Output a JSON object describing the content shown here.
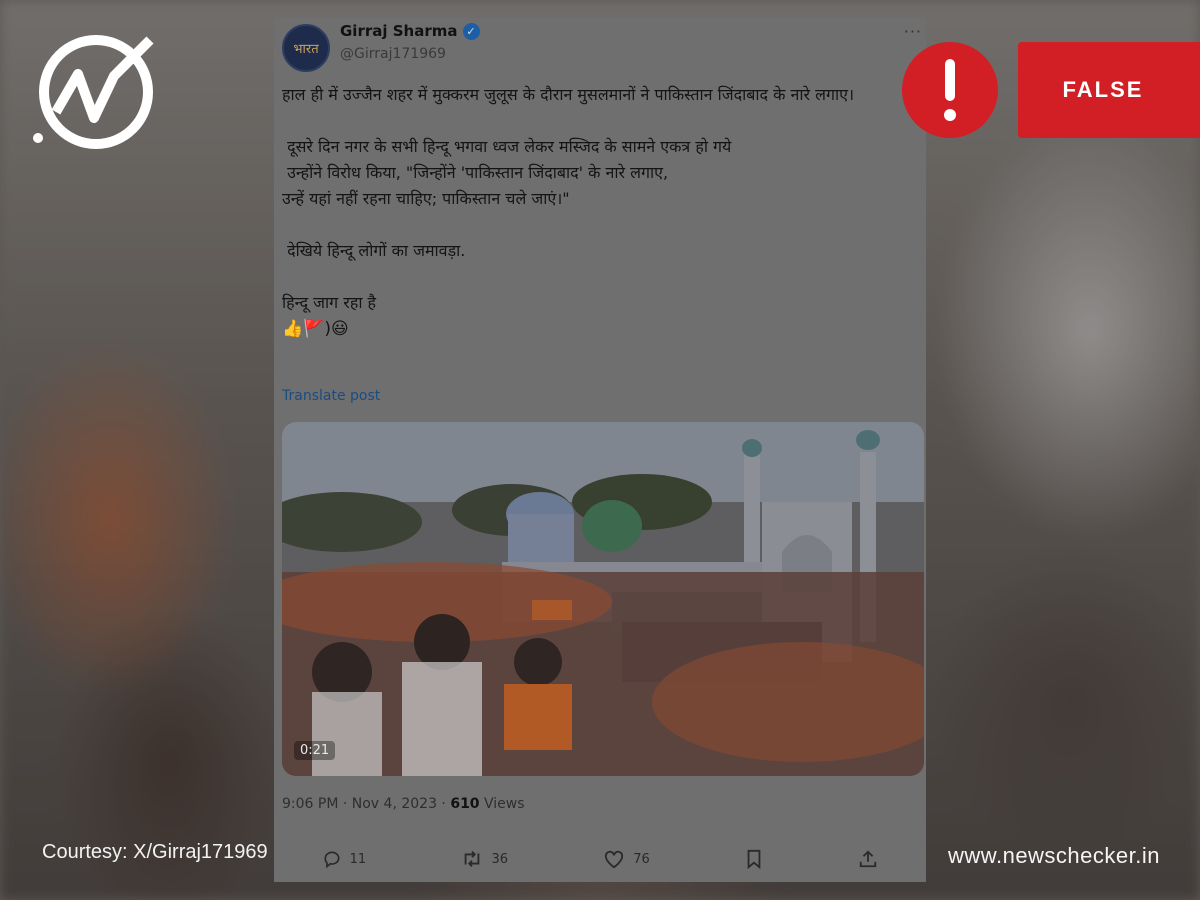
{
  "tweet": {
    "author_name": "Girraj Sharma",
    "handle": "@Girraj171969",
    "avatar_text": "भारत",
    "body_paragraphs": [
      "हाल ही में उज्जैन शहर में मुक्करम जुलूस के दौरान मुसलमानों ने पाकिस्तान जिंदाबाद के नारे लगाए।",
      " दूसरे दिन नगर के सभी हिन्दू भगवा ध्वज लेकर मस्जिद के सामने एकत्र हो गये\n उन्होंने विरोध किया, \"जिन्होंने 'पाकिस्तान जिंदाबाद' के नारे लगाए,\nउन्हें यहां नहीं रहना चाहिए; पाकिस्तान चले जाएं।\"",
      " देखिये हिन्दू लोगों का जमावड़ा.",
      "हिन्दू जाग रहा है"
    ],
    "emoji_line": "👍🚩)😃",
    "translate_label": "Translate post",
    "video_duration": "0:21",
    "timestamp": "9:06 PM · Nov 4, 2023 · ",
    "views_count": "610",
    "views_label": " Views",
    "replies": "11",
    "reposts": "36",
    "likes": "76"
  },
  "badge": {
    "verdict": "FALSE",
    "color": "#d21f26"
  },
  "footer": {
    "courtesy": "Courtesy: X/Girraj171969",
    "site": "www.newschecker.in"
  },
  "icons": [
    "newschecker-logo-icon",
    "verified-icon",
    "more-icon",
    "reply-icon",
    "repost-icon",
    "like-icon",
    "bookmark-icon",
    "share-icon",
    "exclamation-icon"
  ]
}
